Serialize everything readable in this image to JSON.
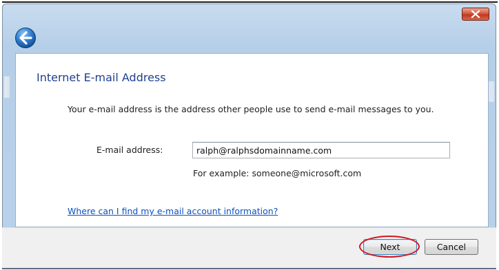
{
  "window": {
    "close_icon": "close-icon",
    "back_icon": "back-arrow-icon"
  },
  "main": {
    "heading": "Internet E-mail Address",
    "description": "Your e-mail address is the address other people use to send e-mail messages to you.",
    "email_label": "E-mail address:",
    "email_value": "ralph@ralphsdomainname.com",
    "example_text": "For example: someone@microsoft.com",
    "help_link": "Where can I find my e-mail account information?"
  },
  "footer": {
    "next_label": "Next",
    "cancel_label": "Cancel"
  },
  "colors": {
    "heading": "#1f3f8f",
    "link": "#0b50c0",
    "highlight_ring": "#d01622",
    "close_button": "#c2381c"
  }
}
